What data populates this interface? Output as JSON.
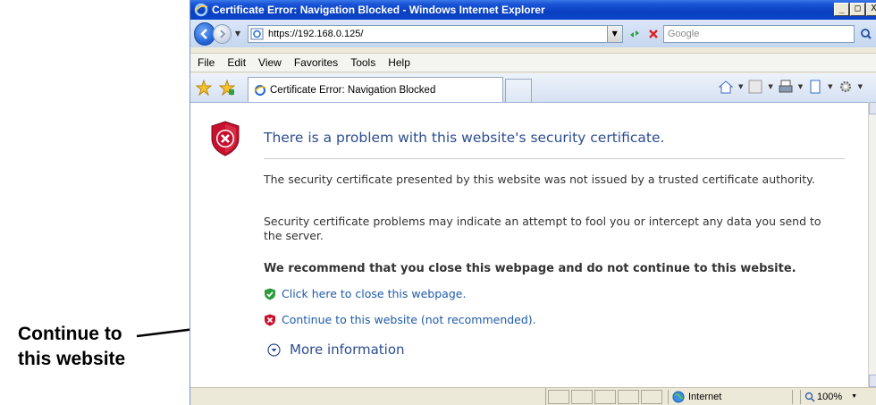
{
  "window": {
    "title": "Certificate Error: Navigation Blocked - Windows Internet Explorer",
    "controls": [
      "_",
      "□",
      "X"
    ]
  },
  "address": {
    "url": "https://192.168.0.125/",
    "search_placeholder": "Google"
  },
  "menu": {
    "items": [
      {
        "label": "File"
      },
      {
        "label": "Edit"
      },
      {
        "label": "View"
      },
      {
        "label": "Favorites"
      },
      {
        "label": "Tools"
      },
      {
        "label": "Help"
      }
    ]
  },
  "tab": {
    "title": "Certificate Error: Navigation Blocked"
  },
  "page": {
    "heading": "There is a problem with this website's security certificate.",
    "paragraph1": "The security certificate presented by this website was not issued by a trusted certificate authority.",
    "paragraph2": "Security certificate problems may indicate an attempt to fool you or intercept any data you send to the server.",
    "recommendation": "We recommend that you close this webpage and do not continue to this website.",
    "close_link": "Click here to close this webpage.",
    "continue_link": "Continue to this website (not recommended).",
    "more_info": "More information"
  },
  "status": {
    "zone": "Internet",
    "zoom": "100%"
  },
  "callout": {
    "line1": "Continue to",
    "line2": "this website"
  },
  "colors": {
    "heading": "#2c4d8f",
    "link": "#1f5aa8",
    "shield_red": "#c8102e",
    "shield_green": "#2e9a3c"
  }
}
